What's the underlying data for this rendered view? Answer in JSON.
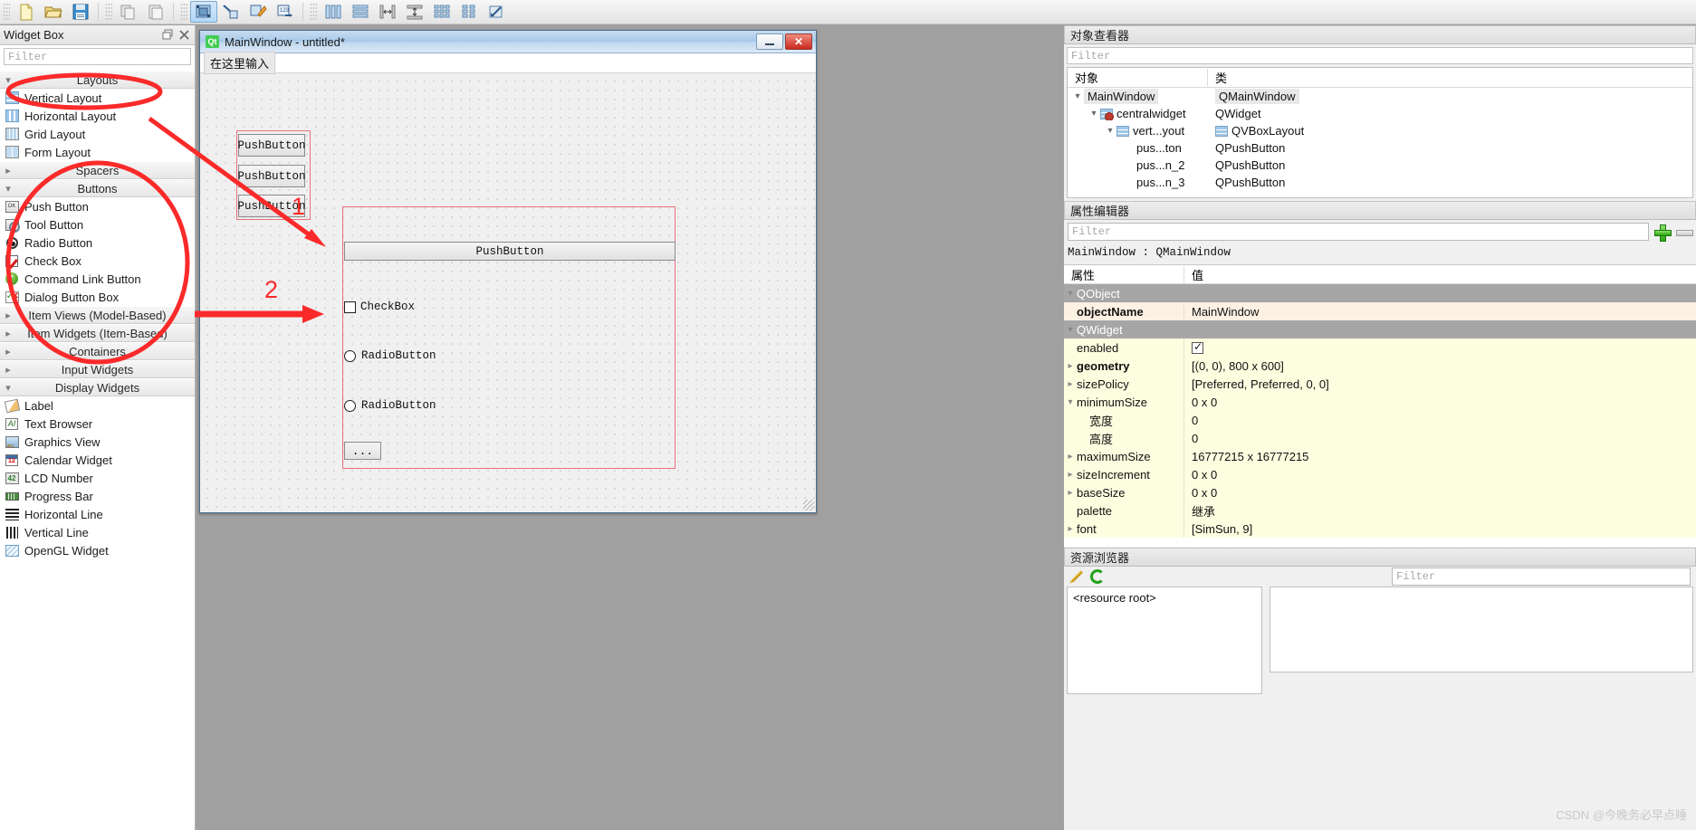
{
  "toolbar": {
    "buttons": [
      {
        "name": "new-file-icon",
        "label": "New"
      },
      {
        "name": "open-file-icon",
        "label": "Open"
      },
      {
        "name": "save-file-icon",
        "label": "Save"
      },
      {
        "name": "copy-icon",
        "label": "Copy"
      },
      {
        "name": "paste-icon",
        "label": "Paste"
      },
      {
        "name": "edit-widgets-icon",
        "label": "Edit Widgets"
      },
      {
        "name": "edit-signals-slots-icon",
        "label": "Edit Signals/Slots"
      },
      {
        "name": "edit-buddies-icon",
        "label": "Edit Buddies"
      },
      {
        "name": "edit-tab-order-icon",
        "label": "Edit Tab Order"
      },
      {
        "name": "layout-horizontally-icon",
        "label": "Lay Out Horizontally"
      },
      {
        "name": "layout-vertically-icon",
        "label": "Lay Out Vertically"
      },
      {
        "name": "layout-splitter-horizontal-icon",
        "label": "Lay Out Horizontally in Splitter"
      },
      {
        "name": "layout-splitter-vertical-icon",
        "label": "Lay Out Vertically in Splitter"
      },
      {
        "name": "layout-grid-icon",
        "label": "Lay Out in a Grid"
      },
      {
        "name": "layout-form-icon",
        "label": "Lay Out in a Form Layout"
      },
      {
        "name": "adjust-size-icon",
        "label": "Adjust Size"
      },
      {
        "name": "break-layout-icon",
        "label": "Break Layout"
      }
    ]
  },
  "widget_box": {
    "title": "Widget Box",
    "filter_placeholder": "Filter",
    "categories": [
      {
        "name": "Layouts",
        "expanded": true,
        "items": [
          {
            "label": "Vertical Layout",
            "icon": "vertical-layout-icon"
          },
          {
            "label": "Horizontal Layout",
            "icon": "horizontal-layout-icon"
          },
          {
            "label": "Grid Layout",
            "icon": "grid-layout-icon"
          },
          {
            "label": "Form Layout",
            "icon": "form-layout-icon"
          }
        ]
      },
      {
        "name": "Spacers",
        "expanded": false,
        "items": []
      },
      {
        "name": "Buttons",
        "expanded": true,
        "items": [
          {
            "label": "Push Button",
            "icon": "push-button-icon"
          },
          {
            "label": "Tool Button",
            "icon": "tool-button-icon"
          },
          {
            "label": "Radio Button",
            "icon": "radio-button-icon"
          },
          {
            "label": "Check Box",
            "icon": "check-box-icon"
          },
          {
            "label": "Command Link Button",
            "icon": "command-link-button-icon"
          },
          {
            "label": "Dialog Button Box",
            "icon": "dialog-button-box-icon"
          }
        ]
      },
      {
        "name": "Item Views (Model-Based)",
        "expanded": false,
        "items": []
      },
      {
        "name": "Item Widgets (Item-Based)",
        "expanded": false,
        "items": []
      },
      {
        "name": "Containers",
        "expanded": false,
        "items": []
      },
      {
        "name": "Input Widgets",
        "expanded": false,
        "items": []
      },
      {
        "name": "Display Widgets",
        "expanded": true,
        "items": [
          {
            "label": "Label",
            "icon": "label-icon"
          },
          {
            "label": "Text Browser",
            "icon": "text-browser-icon"
          },
          {
            "label": "Graphics View",
            "icon": "graphics-view-icon"
          },
          {
            "label": "Calendar Widget",
            "icon": "calendar-widget-icon"
          },
          {
            "label": "LCD Number",
            "icon": "lcd-number-icon"
          },
          {
            "label": "Progress Bar",
            "icon": "progress-bar-icon"
          },
          {
            "label": "Horizontal Line",
            "icon": "horizontal-line-icon"
          },
          {
            "label": "Vertical Line",
            "icon": "vertical-line-icon"
          },
          {
            "label": "OpenGL Widget",
            "icon": "opengl-widget-icon"
          }
        ]
      }
    ]
  },
  "form_window": {
    "title": "MainWindow - untitled*",
    "logo_text": "Qt",
    "menu_placeholder": "在这里输入",
    "laid_out_buttons": [
      "PushButton",
      "PushButton",
      "PushButton"
    ],
    "free_widgets": {
      "push_button": "PushButton",
      "check_box": "CheckBox",
      "radio_button_1": "RadioButton",
      "radio_button_2": "RadioButton",
      "dialog_button": "..."
    }
  },
  "annotations": [
    {
      "label": "1"
    },
    {
      "label": "2"
    }
  ],
  "object_inspector": {
    "title": "对象查看器",
    "filter_placeholder": "Filter",
    "columns": [
      "对象",
      "类"
    ],
    "rows": [
      {
        "indent": 0,
        "twisty": "v",
        "icon": "",
        "object": "MainWindow",
        "class": "QMainWindow",
        "selected": true
      },
      {
        "indent": 1,
        "twisty": "v",
        "icon": "central-widget-icon",
        "object": "centralwidget",
        "class": "QWidget",
        "selected": false
      },
      {
        "indent": 2,
        "twisty": "v",
        "icon": "vbox-layout-icon",
        "object": "vert...yout",
        "class": "QVBoxLayout",
        "class_icon": "vbox-layout-icon",
        "selected": false
      },
      {
        "indent": 3,
        "twisty": "",
        "icon": "",
        "object": "pus...ton",
        "class": "QPushButton",
        "selected": false
      },
      {
        "indent": 3,
        "twisty": "",
        "icon": "",
        "object": "pus...n_2",
        "class": "QPushButton",
        "selected": false
      },
      {
        "indent": 3,
        "twisty": "",
        "icon": "",
        "object": "pus...n_3",
        "class": "QPushButton",
        "selected": false
      }
    ]
  },
  "property_editor": {
    "title": "属性编辑器",
    "filter_placeholder": "Filter",
    "object_class_line": "MainWindow : QMainWindow",
    "columns": [
      "属性",
      "值"
    ],
    "rows": [
      {
        "type": "group",
        "name": "QObject",
        "value": ""
      },
      {
        "type": "prop",
        "name": "objectName",
        "value": "MainWindow",
        "bold": true,
        "expand": "",
        "style": "peach"
      },
      {
        "type": "group",
        "name": "QWidget",
        "value": ""
      },
      {
        "type": "prop",
        "name": "enabled",
        "value": "",
        "widget": "checkbox-checked",
        "expand": "",
        "style": "yellow"
      },
      {
        "type": "prop",
        "name": "geometry",
        "value": "[(0, 0), 800 x 600]",
        "bold": true,
        "expand": ">",
        "style": "yellow"
      },
      {
        "type": "prop",
        "name": "sizePolicy",
        "value": "[Preferred, Preferred, 0, 0]",
        "expand": ">",
        "style": "yellow"
      },
      {
        "type": "prop",
        "name": "minimumSize",
        "value": "0 x 0",
        "expand": "v",
        "style": "yellow"
      },
      {
        "type": "prop",
        "name": "宽度",
        "value": "0",
        "expand": "",
        "indent": true,
        "style": "yellow"
      },
      {
        "type": "prop",
        "name": "高度",
        "value": "0",
        "expand": "",
        "indent": true,
        "style": "yellow"
      },
      {
        "type": "prop",
        "name": "maximumSize",
        "value": "16777215 x 16777215",
        "expand": ">",
        "style": "yellow"
      },
      {
        "type": "prop",
        "name": "sizeIncrement",
        "value": "0 x 0",
        "expand": ">",
        "style": "yellow"
      },
      {
        "type": "prop",
        "name": "baseSize",
        "value": "0 x 0",
        "expand": ">",
        "style": "yellow"
      },
      {
        "type": "prop",
        "name": "palette",
        "value": "继承",
        "expand": "",
        "style": "yellow"
      },
      {
        "type": "prop",
        "name": "font",
        "value": "[SimSun, 9]",
        "expand": ">",
        "style": "yellow"
      }
    ]
  },
  "resource_browser": {
    "title": "资源浏览器",
    "root_label": "<resource root>",
    "filter_placeholder": "Filter",
    "tools": [
      "edit-resources-icon",
      "reload-icon"
    ]
  },
  "watermark": "CSDN @今晚务必早点睡",
  "colors": {
    "accent_red": "#fb2a2a",
    "selection_blue": "#b4d8f7",
    "form_red_outline": "#e8727a",
    "property_yellow": "#fdfde0",
    "property_peach": "#fdf1e3"
  }
}
